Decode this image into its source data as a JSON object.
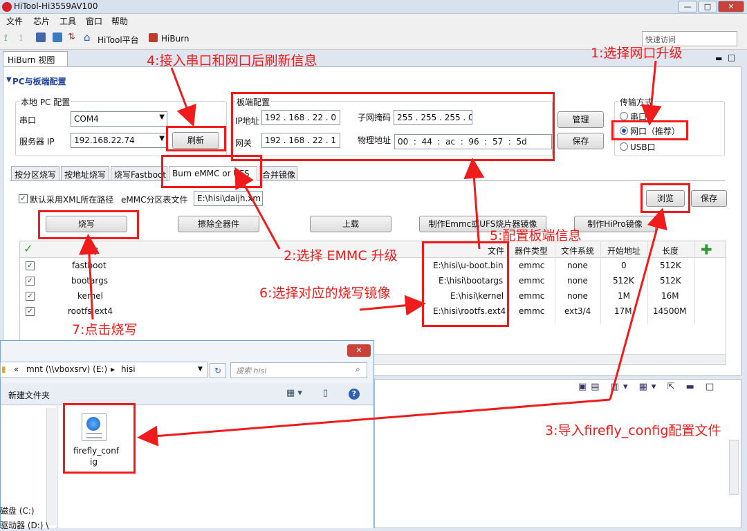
{
  "app": {
    "title": "HiTool-Hi3559AV100",
    "window_buttons": [
      "—",
      "□",
      "✕"
    ]
  },
  "menu": [
    "文件",
    "芯片",
    "工具",
    "窗口",
    "帮助"
  ],
  "toolbar": {
    "hitool_label": "HiTool平台",
    "hiburn_label": "HiBurn",
    "quick_access": "快速访问"
  },
  "view_tab": "HiBurn 视图",
  "section_title": "PC与板端配置",
  "local_pc": {
    "title": "本地 PC 配置",
    "serial_label": "串口",
    "serial_value": "COM4",
    "server_label": "服务器 IP",
    "server_value": "192.168.22.74",
    "refresh": "刷新"
  },
  "board": {
    "title": "板端配置",
    "ip_label": "IP地址",
    "ip_value": "192 . 168 . 22 . 0",
    "mask_label": "子网掩码",
    "mask_value": "255 . 255 . 255 . 0",
    "gw_label": "网关",
    "gw_value": "192 . 168 . 22 . 1",
    "mac_label": "物理地址",
    "mac_value": "00  :  44  :  ac  :  96  :  57  :  5d",
    "manage": "管理",
    "save": "保存"
  },
  "transfer": {
    "title": "传输方式",
    "serial": "串口",
    "net": "网口（推荐）",
    "usb": "USB口",
    "selected": "net"
  },
  "tabs": [
    "按分区烧写",
    "按地址烧写",
    "烧写Fastboot",
    "Burn eMMC or UFS",
    "合并镜像"
  ],
  "active_tab": "Burn eMMC or UFS",
  "xml": {
    "checkbox_label": "默认采用XML所在路径",
    "emmc_label": "eMMC分区表文件",
    "path": "E:\\hisi\\daijh.xm",
    "browse": "浏览",
    "save": "保存"
  },
  "actions": {
    "burn": "烧写",
    "erase": "擦除全器件",
    "upload": "上载",
    "make_emmc": "制作Emmc或UFS烧片器镜像",
    "make_hipro": "制作HiPro镜像"
  },
  "table": {
    "headers": [
      "名称",
      "文件",
      "器件类型",
      "文件系统",
      "开始地址",
      "长度"
    ],
    "rows": [
      {
        "name": "fastboot",
        "file": "E:\\hisi\\u-boot.bin",
        "type": "emmc",
        "fs": "none",
        "start": "0",
        "length": "512K"
      },
      {
        "name": "bootargs",
        "file": "E:\\hisi\\bootargs",
        "type": "emmc",
        "fs": "none",
        "start": "512K",
        "length": "512K"
      },
      {
        "name": "kernel",
        "file": "E:\\hisi\\kernel",
        "type": "emmc",
        "fs": "none",
        "start": "1M",
        "length": "16M"
      },
      {
        "name": "rootfs.ext4",
        "file": "E:\\hisi\\rootfs.ext4",
        "type": "emmc",
        "fs": "ext3/4",
        "start": "17M",
        "length": "14500M"
      }
    ]
  },
  "explorer": {
    "path": [
      "«",
      "mnt (\\\\vboxsrv) (E:)",
      "▸",
      "hisi"
    ],
    "search_placeholder": "搜索 hisi",
    "new_folder": "新建文件夹",
    "file_name_line1": "firefly_conf",
    "file_name_line2": "ig",
    "side_items": [
      "磁盘 (C:)",
      "驱动器 (D:) \\"
    ]
  },
  "annotations": {
    "a1": "1:选择网口升级",
    "a2": "2:选择 EMMC 升级",
    "a3": "3:导入firefly_config配置文件",
    "a4": "4:接入串口和网口后刷新信息",
    "a5": "5:配置板端信息",
    "a6": "6:选择对应的烧写镜像",
    "a7": "7:点击烧写"
  },
  "colors": {
    "annotation": "#f01b1b",
    "section": "#21439f"
  }
}
